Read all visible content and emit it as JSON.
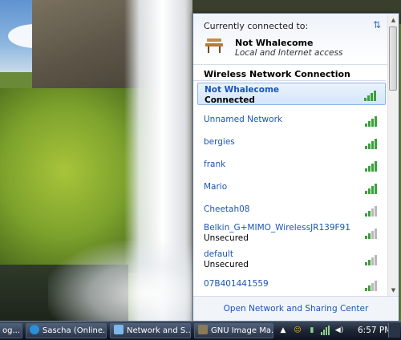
{
  "flyout": {
    "connected_label": "Currently connected to:",
    "current_network": {
      "name": "Not Whalecome",
      "access": "Local and Internet access"
    },
    "section_title": "Wireless Network Connection",
    "networks": [
      {
        "name": "Not Whalecome",
        "status": "Connected",
        "signal": 4
      },
      {
        "name": "Unnamed Network",
        "status": "",
        "signal": 4
      },
      {
        "name": "bergies",
        "status": "",
        "signal": 4
      },
      {
        "name": "frank",
        "status": "",
        "signal": 4
      },
      {
        "name": "Mario",
        "status": "",
        "signal": 4
      },
      {
        "name": "Cheetah08",
        "status": "",
        "signal": 2
      },
      {
        "name": "Belkin_G+MIMO_WirelessJR139F91",
        "status": "Unsecured",
        "signal": 2
      },
      {
        "name": "default",
        "status": "Unsecured",
        "signal": 2
      },
      {
        "name": "07B401441559",
        "status": "",
        "signal": 2
      }
    ],
    "footer_link": "Open Network and Sharing Center"
  },
  "taskbar": {
    "tasks": [
      {
        "label": "og..."
      },
      {
        "label": "Sascha (Online..."
      },
      {
        "label": "Network and S..."
      },
      {
        "label": "GNU Image Ma..."
      }
    ],
    "tray_arrow": "▲",
    "clock": "6:57 PM"
  },
  "colors": {
    "link_blue": "#1a55b4",
    "signal_green": "#3ba03b",
    "taskbar_dark": "#1d2535"
  }
}
